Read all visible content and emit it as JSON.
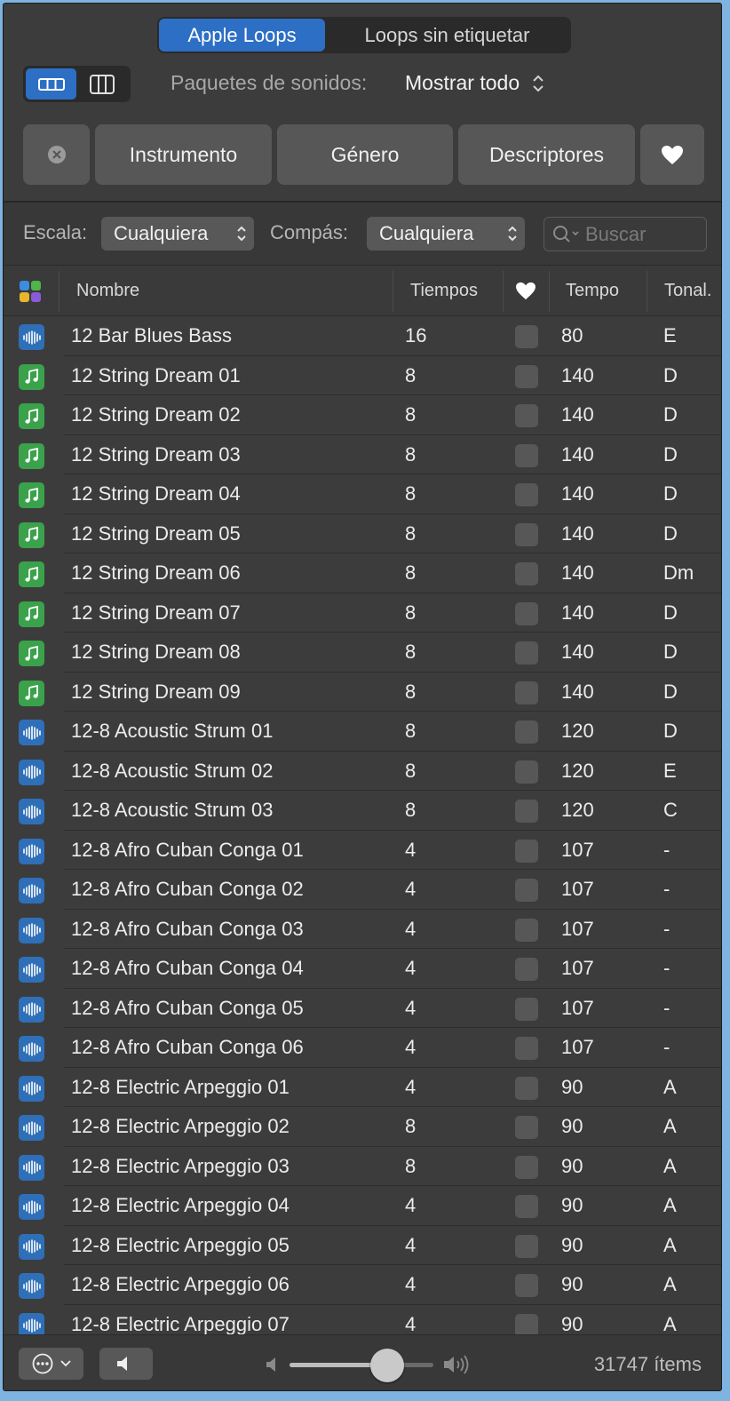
{
  "segmented": {
    "active": "Apple Loops",
    "inactive": "Loops sin etiquetar"
  },
  "packs": {
    "label": "Paquetes de sonidos:",
    "value": "Mostrar todo"
  },
  "filters": {
    "instrument": "Instrumento",
    "genre": "Género",
    "descriptors": "Descriptores"
  },
  "selectors": {
    "scale_label": "Escala:",
    "scale_value": "Cualquiera",
    "time_label": "Compás:",
    "time_value": "Cualquiera",
    "search_placeholder": "Buscar"
  },
  "columns": {
    "name": "Nombre",
    "beats": "Tiempos",
    "tempo": "Tempo",
    "key": "Tonal."
  },
  "rows": [
    {
      "type": "audio",
      "name": "12 Bar Blues Bass",
      "beats": "16",
      "tempo": "80",
      "key": "E"
    },
    {
      "type": "midi",
      "name": "12 String Dream 01",
      "beats": "8",
      "tempo": "140",
      "key": "D"
    },
    {
      "type": "midi",
      "name": "12 String Dream 02",
      "beats": "8",
      "tempo": "140",
      "key": "D"
    },
    {
      "type": "midi",
      "name": "12 String Dream 03",
      "beats": "8",
      "tempo": "140",
      "key": "D"
    },
    {
      "type": "midi",
      "name": "12 String Dream 04",
      "beats": "8",
      "tempo": "140",
      "key": "D"
    },
    {
      "type": "midi",
      "name": "12 String Dream 05",
      "beats": "8",
      "tempo": "140",
      "key": "D"
    },
    {
      "type": "midi",
      "name": "12 String Dream 06",
      "beats": "8",
      "tempo": "140",
      "key": "Dm"
    },
    {
      "type": "midi",
      "name": "12 String Dream 07",
      "beats": "8",
      "tempo": "140",
      "key": "D"
    },
    {
      "type": "midi",
      "name": "12 String Dream 08",
      "beats": "8",
      "tempo": "140",
      "key": "D"
    },
    {
      "type": "midi",
      "name": "12 String Dream 09",
      "beats": "8",
      "tempo": "140",
      "key": "D"
    },
    {
      "type": "audio",
      "name": "12-8 Acoustic Strum 01",
      "beats": "8",
      "tempo": "120",
      "key": "D"
    },
    {
      "type": "audio",
      "name": "12-8 Acoustic Strum 02",
      "beats": "8",
      "tempo": "120",
      "key": "E"
    },
    {
      "type": "audio",
      "name": "12-8 Acoustic Strum 03",
      "beats": "8",
      "tempo": "120",
      "key": "C"
    },
    {
      "type": "audio",
      "name": "12-8 Afro Cuban Conga 01",
      "beats": "4",
      "tempo": "107",
      "key": "-"
    },
    {
      "type": "audio",
      "name": "12-8 Afro Cuban Conga 02",
      "beats": "4",
      "tempo": "107",
      "key": "-"
    },
    {
      "type": "audio",
      "name": "12-8 Afro Cuban Conga 03",
      "beats": "4",
      "tempo": "107",
      "key": "-"
    },
    {
      "type": "audio",
      "name": "12-8 Afro Cuban Conga 04",
      "beats": "4",
      "tempo": "107",
      "key": "-"
    },
    {
      "type": "audio",
      "name": "12-8 Afro Cuban Conga 05",
      "beats": "4",
      "tempo": "107",
      "key": "-"
    },
    {
      "type": "audio",
      "name": "12-8 Afro Cuban Conga 06",
      "beats": "4",
      "tempo": "107",
      "key": "-"
    },
    {
      "type": "audio",
      "name": "12-8 Electric Arpeggio 01",
      "beats": "4",
      "tempo": "90",
      "key": "A"
    },
    {
      "type": "audio",
      "name": "12-8 Electric Arpeggio 02",
      "beats": "8",
      "tempo": "90",
      "key": "A"
    },
    {
      "type": "audio",
      "name": "12-8 Electric Arpeggio 03",
      "beats": "8",
      "tempo": "90",
      "key": "A"
    },
    {
      "type": "audio",
      "name": "12-8 Electric Arpeggio 04",
      "beats": "4",
      "tempo": "90",
      "key": "A"
    },
    {
      "type": "audio",
      "name": "12-8 Electric Arpeggio 05",
      "beats": "4",
      "tempo": "90",
      "key": "A"
    },
    {
      "type": "audio",
      "name": "12-8 Electric Arpeggio 06",
      "beats": "4",
      "tempo": "90",
      "key": "A"
    },
    {
      "type": "audio",
      "name": "12-8 Electric Arpeggio 07",
      "beats": "4",
      "tempo": "90",
      "key": "A"
    }
  ],
  "footer": {
    "count": "31747 ítems",
    "volume_level": 0.68
  },
  "colors": {
    "accent": "#2d6fc4",
    "audio_icon": "#2f6fb8",
    "midi_icon": "#3aa24a"
  }
}
